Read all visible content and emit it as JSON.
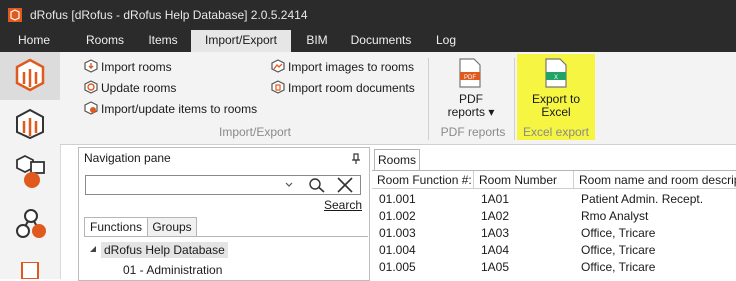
{
  "window": {
    "title": "dRofus [dRofus - dRofus Help Database] 2.0.5.2414"
  },
  "menu": {
    "tabs": [
      "Home",
      "Rooms",
      "Items",
      "Import/Export",
      "BIM",
      "Documents",
      "Log"
    ],
    "active": "Import/Export"
  },
  "ribbon": {
    "import_group": {
      "label": "Import/Export",
      "import_rooms": "Import rooms",
      "update_rooms": "Update rooms",
      "import_update_items": "Import/update items to rooms",
      "import_images": "Import images to rooms",
      "import_room_documents": "Import room documents"
    },
    "pdf_group": {
      "label": "PDF reports",
      "button_line1": "PDF",
      "button_line2": "reports ▾",
      "icon_text": "PDF"
    },
    "excel_group": {
      "label": "Excel export",
      "button_line1": "Export to",
      "button_line2": "Excel",
      "icon_text": "X",
      "highlight_color": "#f5f542"
    }
  },
  "nav_pane": {
    "title": "Navigation pane",
    "search_value": "",
    "search_link": "Search",
    "tabs": [
      "Functions",
      "Groups"
    ],
    "active_tab": "Functions",
    "tree": {
      "root": "dRofus Help Database",
      "child": "01 - Administration"
    }
  },
  "rooms_pane": {
    "tab": "Rooms",
    "columns": [
      "Room Function #:",
      "Room Number",
      "Room name and room descrip"
    ],
    "rows": [
      [
        "01.001",
        "1A01",
        "Patient Admin. Recept."
      ],
      [
        "01.002",
        "1A02",
        "Rmo Analyst"
      ],
      [
        "01.003",
        "1A03",
        "Office, Tricare"
      ],
      [
        "01.004",
        "1A04",
        "Office, Tricare"
      ],
      [
        "01.005",
        "1A05",
        "Office, Tricare"
      ]
    ]
  },
  "colors": {
    "accent": "#e05a1f",
    "titlebar": "#2b2b2b",
    "ribbon": "#f3f3f3"
  }
}
